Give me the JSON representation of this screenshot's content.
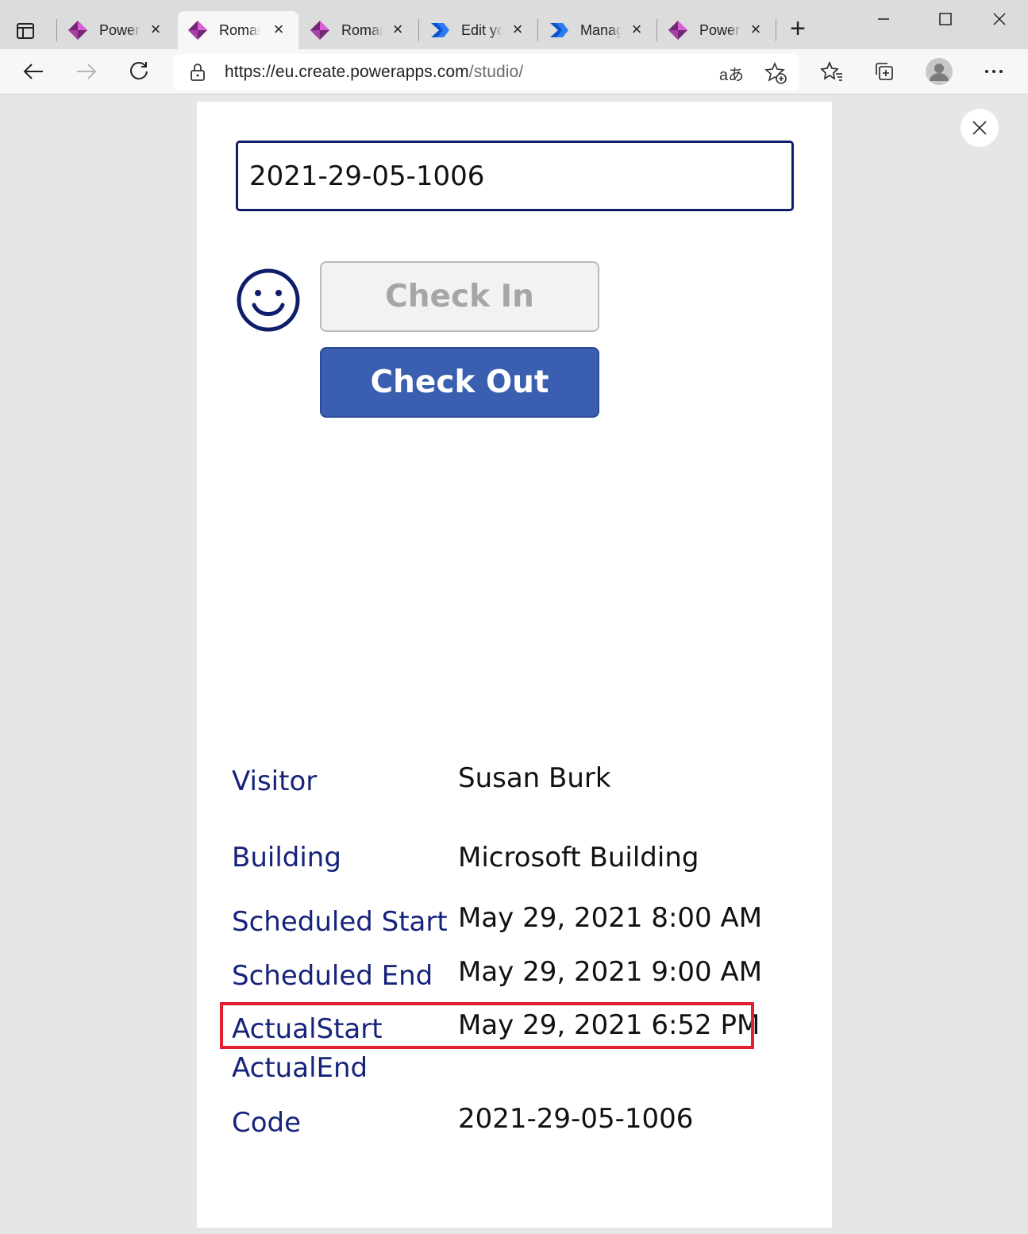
{
  "browser": {
    "tabs": [
      {
        "label": "Power",
        "icon": "powerapps-icon",
        "active": false
      },
      {
        "label": "Roman",
        "icon": "powerapps-icon",
        "active": true
      },
      {
        "label": "Roman",
        "icon": "powerapps-icon",
        "active": false
      },
      {
        "label": "Edit yo",
        "icon": "power-automate-icon",
        "active": false
      },
      {
        "label": "Manag",
        "icon": "power-automate-icon",
        "active": false
      },
      {
        "label": "Power",
        "icon": "powerapps-icon",
        "active": false
      }
    ],
    "url_host": "https://eu.create.powerapps.com",
    "url_path": "/studio/",
    "read_aloud": "aあ"
  },
  "app": {
    "code_input_value": "2021-29-05-1006",
    "check_in_label": "Check In",
    "check_out_label": "Check Out",
    "check_in_enabled": false,
    "fields": [
      {
        "label": "Visitor",
        "value": "Susan Burk"
      },
      {
        "label": "Building",
        "value": "Microsoft Building"
      },
      {
        "label": "Scheduled Start",
        "value": "May 29, 2021 8:00 AM"
      },
      {
        "label": "Scheduled End",
        "value": "May 29, 2021 9:00 AM"
      },
      {
        "label": "ActualStart",
        "value": "May 29, 2021 6:52 PM"
      },
      {
        "label": "ActualEnd",
        "value": ""
      },
      {
        "label": "Code",
        "value": "2021-29-05-1006"
      }
    ]
  },
  "colors": {
    "label_text": "#16237a",
    "check_out_bg": "#3a5fb0",
    "highlight_border": "#e0202e"
  }
}
